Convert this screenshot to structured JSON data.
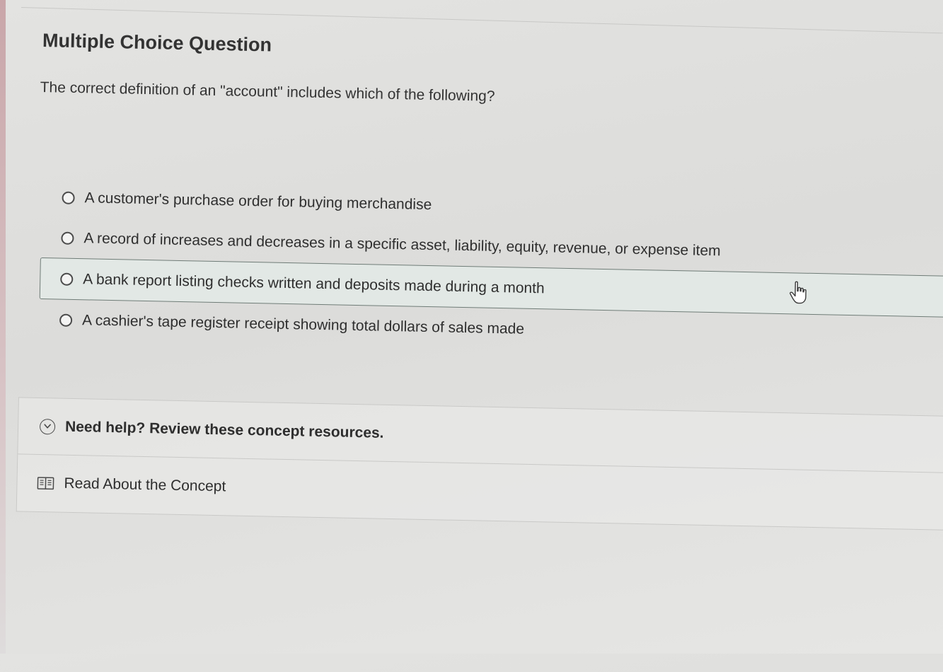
{
  "heading": "Multiple Choice Question",
  "question": "The correct definition of an \"account\" includes which of the following?",
  "options": [
    {
      "label": "A customer's purchase order for buying merchandise",
      "selected": false
    },
    {
      "label": "A record of increases and decreases in a specific asset, liability, equity, revenue, or expense item",
      "selected": false
    },
    {
      "label": "A bank report listing checks written and deposits made during a month",
      "selected": false
    },
    {
      "label": "A cashier's tape register receipt showing total dollars of sales made",
      "selected": false
    }
  ],
  "help": {
    "title": "Need help? Review these concept resources.",
    "resource_label": "Read About the Concept"
  },
  "colors": {
    "hover_background": "#e2e8e5",
    "hover_border": "#6f7c77",
    "text": "#2e2e2e"
  },
  "icons": {
    "radio": "radio-unchecked-icon",
    "chevron": "chevron-down-circle-icon",
    "book": "book-icon",
    "cursor": "hand-pointer-cursor-icon"
  }
}
